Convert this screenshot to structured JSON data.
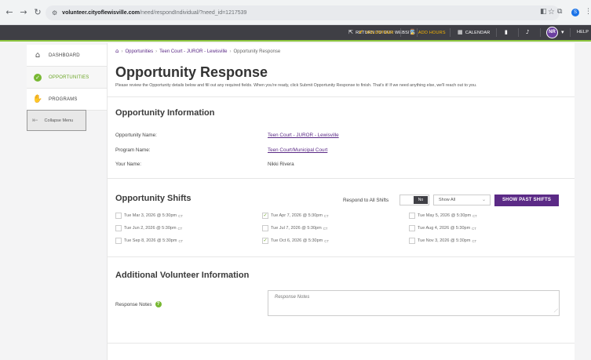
{
  "browser": {
    "nav_back": "←",
    "nav_forward": "→",
    "nav_reload": "↻",
    "url_host": "volunteer.cityoflewisville.com",
    "url_path": "/need/respondIndividual/?need_id=1217539",
    "profile_initial": "S"
  },
  "topnav": {
    "return_label": "RETURN TO OUR WEBSITE",
    "volunteer_label": "VOLUNTEER",
    "add_hours_label": "ADD HOURS",
    "calendar_label": "CALENDAR",
    "avatar_initials": "NR",
    "help_label": "HELP",
    "accent_color": "#f5b400",
    "bar_color": "#3f3f45",
    "green_line_color": "#8dc63f"
  },
  "sidebar": {
    "items": [
      {
        "label": "DASHBOARD",
        "icon": "home-icon"
      },
      {
        "label": "OPPORTUNITIES",
        "icon": "check-circle-icon",
        "active": true
      },
      {
        "label": "PROGRAMS",
        "icon": "hand-heart-icon"
      }
    ],
    "collapse_label": "Collapse Menu"
  },
  "breadcrumb": {
    "opportunities": "Opportunities",
    "need": "Teen Court - JUROR - Lewisville",
    "current": "Opportunity Response"
  },
  "page": {
    "title": "Opportunity Response",
    "description": "Please review the Opportunity details below and fill out any required fields. When you're ready, click Submit Opportunity Response to finish. That's it! If we need anything else, we'll reach out to you."
  },
  "opportunity_info": {
    "section_title": "Opportunity Information",
    "name_label": "Opportunity Name:",
    "name_value": "Teen Court - JUROR - Lewisville",
    "program_label": "Program Name:",
    "program_value": "Teen Court/Municipal Court",
    "your_name_label": "Your Name:",
    "your_name_value": "Nikki Rivera"
  },
  "shifts": {
    "section_title": "Opportunity Shifts",
    "respond_all_label": "Respond to All Shifts",
    "toggle_value": "No",
    "filter_value": "Show All",
    "past_button": "SHOW PAST SHIFTS",
    "timezone": "CT",
    "items": [
      {
        "label": "Tue Mar 3, 2026 @ 5:30pm",
        "checked": false
      },
      {
        "label": "Tue Apr 7, 2026 @ 5:30pm",
        "checked": true
      },
      {
        "label": "Tue May 5, 2026 @ 5:30pm",
        "checked": false
      },
      {
        "label": "Tue Jun 2, 2026 @ 5:30pm",
        "checked": false
      },
      {
        "label": "Tue Jul 7, 2026 @ 5:30pm",
        "checked": false
      },
      {
        "label": "Tue Aug 4, 2026 @ 5:30pm",
        "checked": false
      },
      {
        "label": "Tue Sep 8, 2026 @ 5:30pm",
        "checked": false
      },
      {
        "label": "Tue Oct 6, 2026 @ 5:30pm",
        "checked": true
      },
      {
        "label": "Tue Nov 3, 2026 @ 5:30pm",
        "checked": false
      }
    ]
  },
  "additional": {
    "section_title": "Additional Volunteer Information",
    "notes_label": "Response Notes",
    "notes_placeholder": "Response Notes"
  },
  "colors": {
    "brand_purple": "#5b2a86",
    "brand_green": "#78b833"
  }
}
